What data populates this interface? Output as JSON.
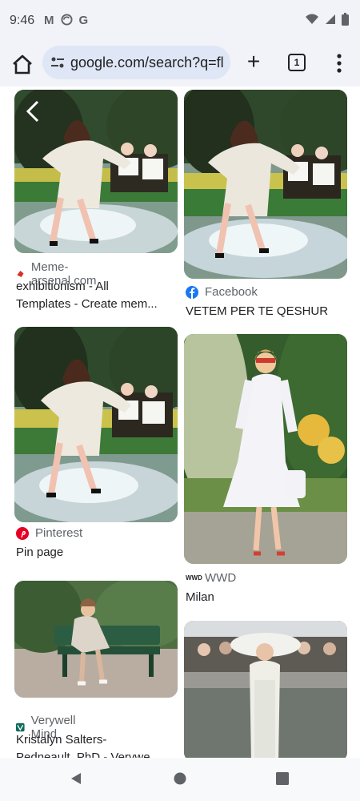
{
  "status_bar": {
    "time": "9:46",
    "left_icons": [
      "gmail-icon",
      "sync-icon",
      "google-icon"
    ],
    "right_icons": [
      "wifi-icon",
      "signal-icon",
      "battery-icon"
    ]
  },
  "toolbar": {
    "url": "google.com/search?q=fl",
    "tab_count": "1"
  },
  "results": [
    {
      "source": "Meme-arsenal.com",
      "title_lines": [
        "exhibitionism - All",
        "Templates - Create mem..."
      ],
      "source_icon": "meme-arsenal-icon"
    },
    {
      "source": "Facebook",
      "title_lines": [
        "VETEM PER TE QESHUR"
      ],
      "source_icon": "facebook-icon"
    },
    {
      "source": "Pinterest",
      "title_lines": [
        "Pin page"
      ],
      "source_icon": "pinterest-icon"
    },
    {
      "source": "WWD",
      "title_lines": [
        "Milan"
      ],
      "source_icon": "wwd-icon"
    },
    {
      "source": "Verywell Mind",
      "title_lines": [
        "Kristalyn Salters-",
        "Pedneault, PhD - Verywe..."
      ],
      "source_icon": "verywell-icon"
    }
  ],
  "wwd_logo": "WWD",
  "colors": {
    "toolbar_bg": "#f1f3f8",
    "urlbar_bg": "#dfe6f5",
    "facebook": "#1877f2",
    "pinterest": "#e60023",
    "meme_arsenal": "#d93025",
    "verywell": "#0f6b5c"
  },
  "navigation": [
    "back-icon",
    "home-circle-icon",
    "recents-icon"
  ]
}
